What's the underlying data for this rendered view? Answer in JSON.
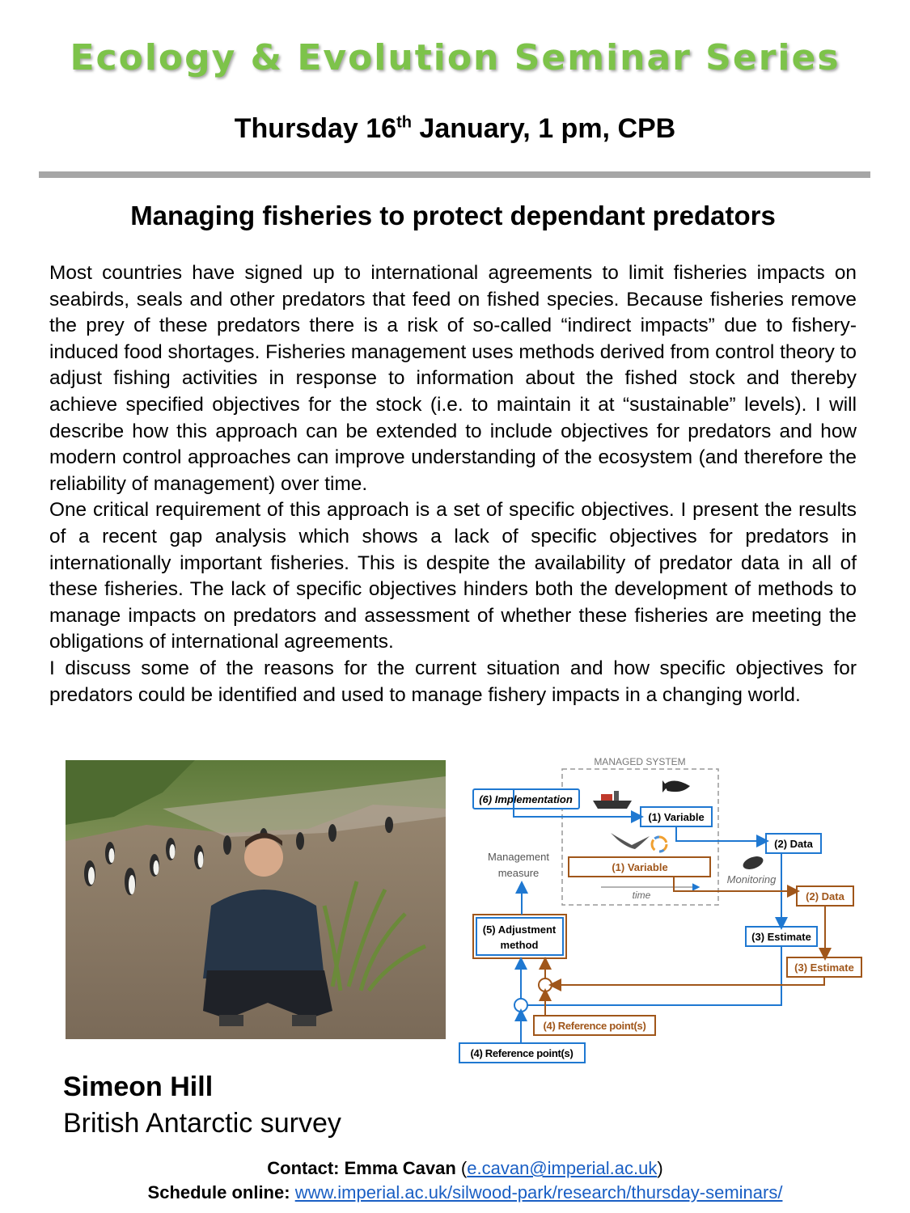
{
  "header": {
    "series_title": "Ecology & Evolution Seminar Series",
    "date_day": "Thursday 16",
    "date_suffix": "th",
    "date_rest": " January, 1 pm, CPB",
    "accent_color": "#7dc34a",
    "rule_color": "#a6a6a6"
  },
  "talk": {
    "title": "Managing fisheries to protect dependant predators",
    "paragraphs": [
      "Most countries have signed up to international agreements to limit fisheries impacts on seabirds, seals and other predators that feed on fished species. Because fisheries remove the prey of these predators there is a risk of so-called “indirect impacts” due to fishery-induced food shortages. Fisheries management uses methods derived from control theory to adjust fishing activities in response to information about the fished stock and thereby achieve specified objectives for the stock (i.e. to maintain it at “sustainable” levels). I will describe how this approach can be extended to include objectives for predators and how modern control approaches can improve understanding of the ecosystem (and therefore the reliability of management) over time.",
      "One critical requirement of this approach is a set of specific objectives. I present the results of a recent gap analysis which shows a lack of specific objectives for predators in internationally important fisheries. This is despite the availability of predator data in all of these fisheries. The lack of specific objectives hinders both the development of methods to manage impacts on predators and assessment of whether these fisheries are meeting the obligations of international agreements.",
      "I discuss some of the reasons for the current situation and how specific objectives for predators could be identified and used to manage fishery impacts in a changing world."
    ]
  },
  "diagram": {
    "managed_system": "MANAGED SYSTEM",
    "implementation": "(6) Implementation",
    "variable_blue": "(1)  Variable",
    "data_blue": "(2) Data",
    "management_measure_1": "Management",
    "management_measure_2": "measure",
    "variable_brown": "(1) Variable",
    "monitoring": "Monitoring",
    "time": "time",
    "data_brown": "(2) Data",
    "adjustment_1": "(5) Adjustment",
    "adjustment_2": "method",
    "estimate_blue": "(3) Estimate",
    "estimate_brown": "(3) Estimate",
    "reference_brown": "(4) Reference point(s)",
    "reference_blue": "(4) Reference point(s)",
    "blue_color": "#1f78d1",
    "brown_color": "#a0561a"
  },
  "speaker": {
    "name": "Simeon Hill",
    "institution": "British Antarctic survey"
  },
  "footer": {
    "contact_label": "Contact: Emma Cavan",
    "contact_open": " (",
    "contact_email": "e.cavan@imperial.ac.uk",
    "contact_close": ")",
    "schedule_label": "Schedule online:",
    "schedule_url": "www.imperial.ac.uk/silwood-park/research/thursday-seminars/"
  }
}
